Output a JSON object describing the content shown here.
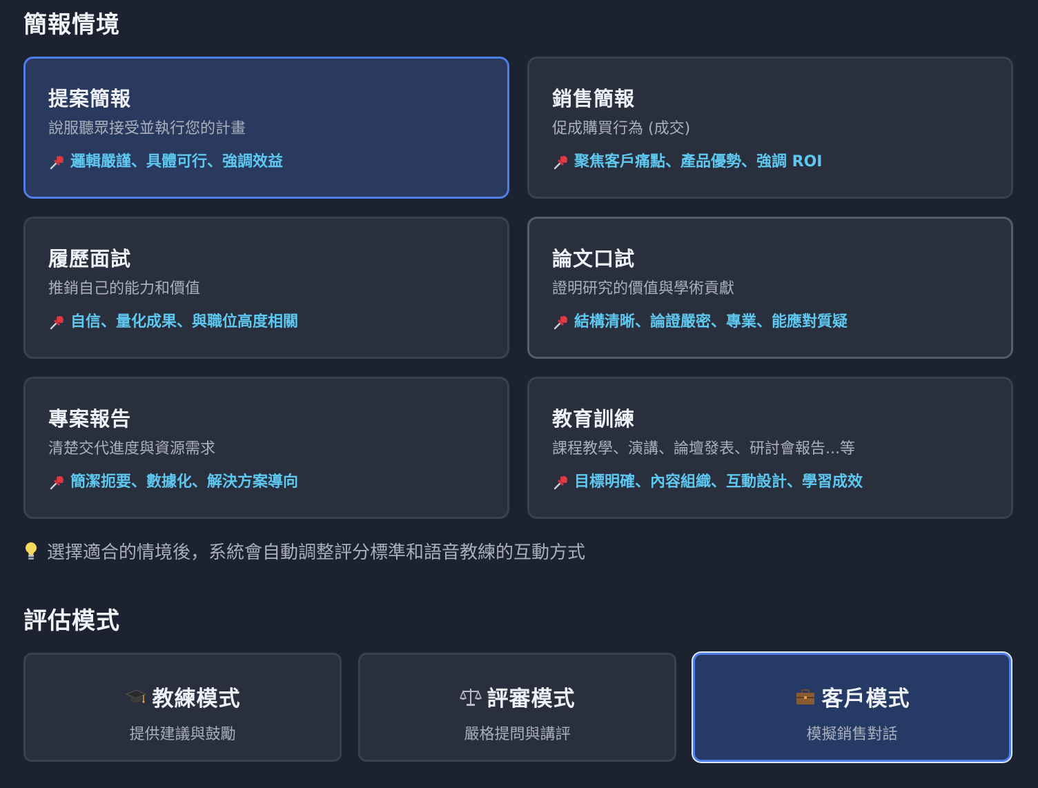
{
  "scenario_section": {
    "title": "簡報情境",
    "cards": [
      {
        "title": "提案簡報",
        "desc": "說服聽眾接受並執行您的計畫",
        "tip": "邏輯嚴謹、具體可行、強調效益",
        "selected": true
      },
      {
        "title": "銷售簡報",
        "desc": "促成購買行為 (成交)",
        "tip": "聚焦客戶痛點、產品優勢、強調 ROI",
        "selected": false
      },
      {
        "title": "履歷面試",
        "desc": "推銷自己的能力和價值",
        "tip": "自信、量化成果、與職位高度相關",
        "selected": false
      },
      {
        "title": "論文口試",
        "desc": "證明研究的價值與學術貢獻",
        "tip": "結構清晰、論證嚴密、專業、能應對質疑",
        "selected": false
      },
      {
        "title": "專案報告",
        "desc": "清楚交代進度與資源需求",
        "tip": "簡潔扼要、數據化、解決方案導向",
        "selected": false
      },
      {
        "title": "教育訓練",
        "desc": "課程教學、演講、論壇發表、研討會報告...等",
        "tip": "目標明確、內容組織、互動設計、學習成效",
        "selected": false
      }
    ],
    "hint": "選擇適合的情境後，系統會自動調整評分標準和語音教練的互動方式"
  },
  "mode_section": {
    "title": "評估模式",
    "modes": [
      {
        "icon": "graduation-cap-icon",
        "title": "教練模式",
        "desc": "提供建議與鼓勵",
        "selected": false
      },
      {
        "icon": "scales-icon",
        "title": "評審模式",
        "desc": "嚴格提問與講評",
        "selected": false
      },
      {
        "icon": "briefcase-icon",
        "title": "客戶模式",
        "desc": "模擬銷售對話",
        "selected": true
      }
    ]
  },
  "colors": {
    "background": "#1d2230",
    "card": "#2a2f3d",
    "selected_card": "#2a3a5e",
    "accent_border": "#4f7ee8",
    "tip_text": "#5ec8f0"
  }
}
